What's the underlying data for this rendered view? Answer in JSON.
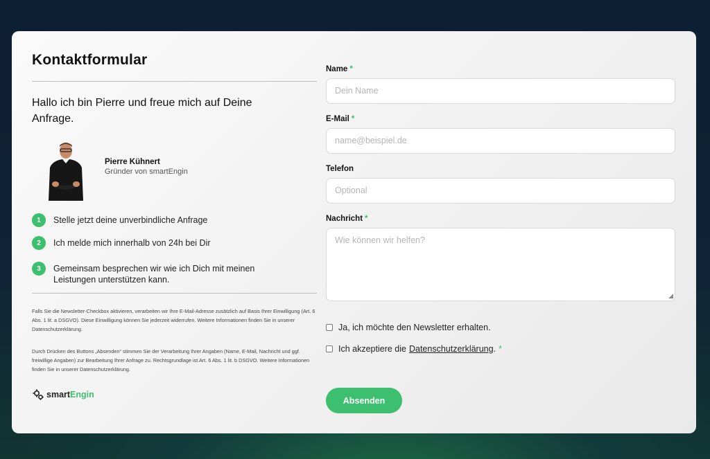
{
  "left": {
    "title": "Kontaktformular",
    "intro": "Hallo ich bin Pierre und freue mich auf Deine Anfrage.",
    "person": {
      "name": "Pierre Kühnert",
      "role": "Gründer von smartEngin"
    },
    "steps": [
      {
        "num": "1",
        "text": "Stelle jetzt deine unverbindliche Anfrage"
      },
      {
        "num": "2",
        "text": "Ich melde mich innerhalb von 24h bei Dir"
      },
      {
        "num": "3",
        "text": "Gemeinsam besprechen wir wie ich Dich mit meinen Leistungen unterstützen kann."
      }
    ],
    "privacy1": "Falls Sie die Newsletter-Checkbox aktivieren, verarbeiten wir Ihre E-Mail-Adresse zusätzlich auf Basis Ihrer Einwilligung (Art. 6 Abs. 1 lit. a DSGVO). Diese Einwilligung können Sie jederzeit widerrufen. Weitere Informationen finden Sie in unserer Datenschutzerklärung.",
    "privacy2": "Durch Drücken des Buttons „Absenden“ stimmen Sie der Verarbeitung Ihrer Angaben (Name, E-Mail, Nachricht und ggf. freiwillige Angaben) zur Bearbeitung Ihrer Anfrage zu. Rechtsgrundlage ist Art. 6 Abs. 1 lit. b DSGVO. Weitere Informationen finden Sie in unserer Datenschutzerklärung.",
    "logo": {
      "part1": "smart",
      "part2": "Engin"
    }
  },
  "form": {
    "name": {
      "label": "Name",
      "required": "*",
      "placeholder": "Dein Name",
      "value": ""
    },
    "email": {
      "label": "E-Mail",
      "required": "*",
      "placeholder": "name@beispiel.de",
      "value": ""
    },
    "phone": {
      "label": "Telefon",
      "placeholder": "Optional",
      "value": ""
    },
    "message": {
      "label": "Nachricht",
      "required": "*",
      "placeholder": "Wie können wir helfen?",
      "value": ""
    },
    "newsletter": {
      "label": "Ja, ich möchte den Newsletter erhalten.",
      "checked": false
    },
    "privacy": {
      "label": "Ich akzeptiere die",
      "link": "Datenschutzerklärung",
      "suffix": ".",
      "required": "*",
      "checked": false
    },
    "submit": "Absenden"
  },
  "colors": {
    "accent": "#3cbf6e",
    "card": "#f1f1f1",
    "background": "#0d1f33"
  }
}
